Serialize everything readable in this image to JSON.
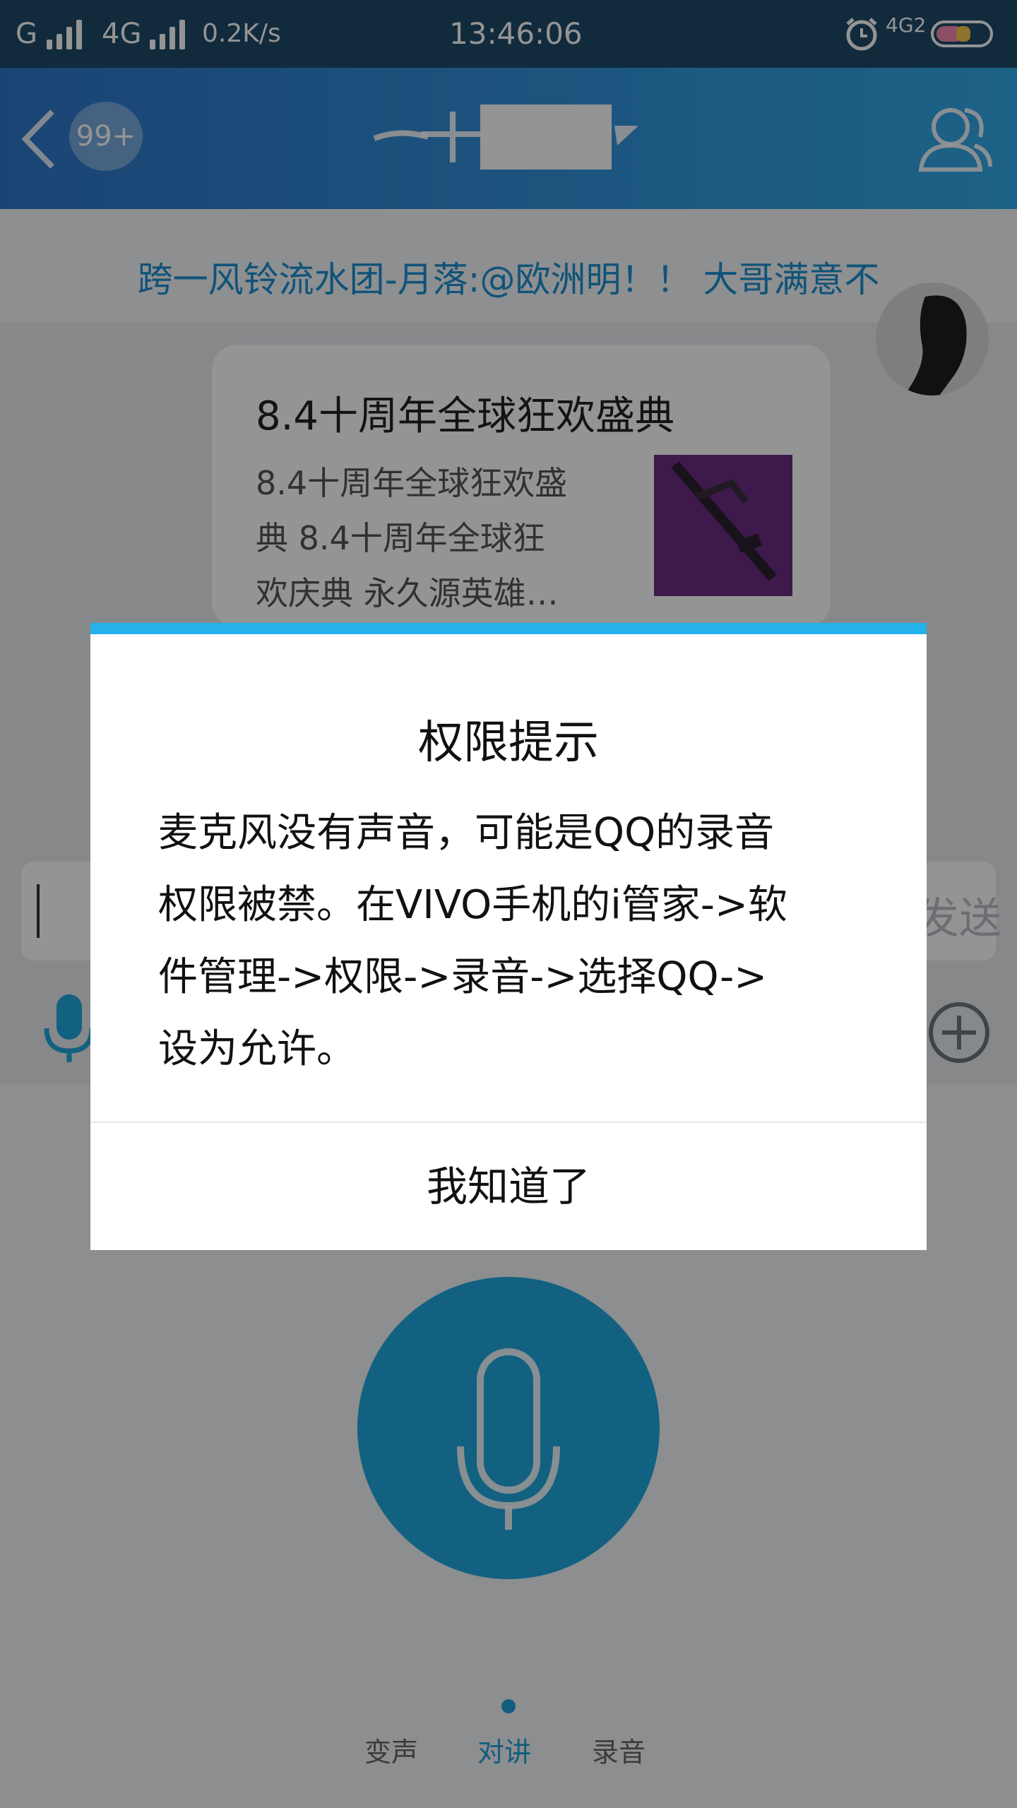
{
  "status_bar": {
    "carrier1": "G",
    "carrier2": "4G",
    "speed": "0.2K/s",
    "time": "13:46:06",
    "net_badge": "4G2"
  },
  "header": {
    "unread_badge": "99+"
  },
  "banner": {
    "text": "跨一风铃流水团-月落:@欧洲明！！  大哥满意不"
  },
  "bubble": {
    "title": "8.4十周年全球狂欢盛典",
    "lines": [
      "8.4十周年全球狂欢盛",
      "典 8.4十周年全球狂",
      "欢庆典 永久源英雄…"
    ]
  },
  "input": {
    "send_label": "发送"
  },
  "bottom_tabs": {
    "voice_change": "变声",
    "talk": "对讲",
    "record": "录音"
  },
  "dialog": {
    "title": "权限提示",
    "lines": [
      "麦克风没有声音，可能是QQ的录音",
      "权限被禁。在VIVO手机的i管家->软",
      "件管理->权限->录音->选择QQ->",
      "设为允许。"
    ],
    "confirm_label": "我知道了"
  },
  "colors": {
    "header_start": "#2f76c9",
    "header_end": "#33a9e8",
    "accent": "#25b1ea",
    "mic": "#20a8dd"
  }
}
